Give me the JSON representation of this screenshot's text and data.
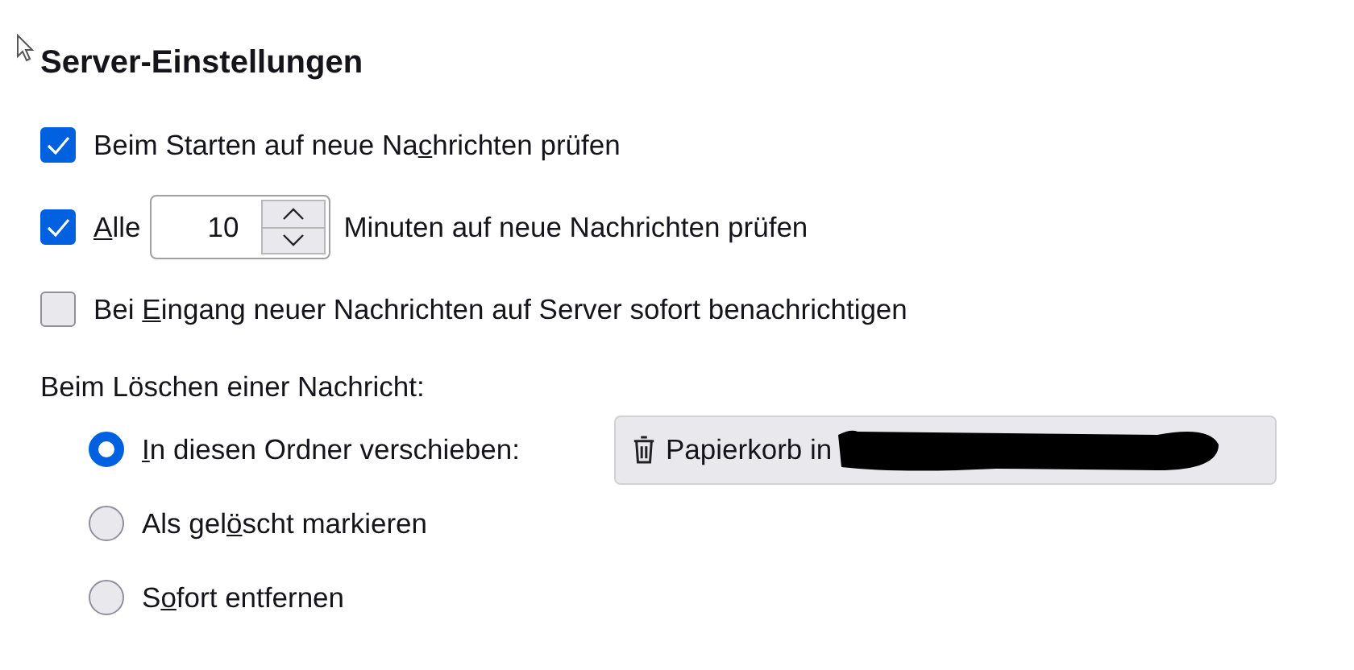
{
  "heading": "Server-Einstellungen",
  "options": [
    {
      "kind": "checkbox",
      "checked": true,
      "label": [
        "Beim Starten auf neue Na",
        "c",
        "hrichten prüfen"
      ]
    },
    {
      "kind": "interval",
      "checked": true,
      "label": [
        "A",
        "lle"
      ],
      "value": "10",
      "suffix": "Minuten auf neue Nachrichten prüfen"
    },
    {
      "kind": "checkbox",
      "checked": false,
      "label": [
        "Bei ",
        "E",
        "ingang neuer Nachrichten auf Server sofort benachrichtigen"
      ]
    }
  ],
  "delete_group": {
    "title": "Beim Löschen einer Nachricht:",
    "choices": [
      {
        "selected": true,
        "label": [
          "I",
          "n diesen Ordner verschieben:"
        ],
        "folder": {
          "label": "Papierkorb in",
          "redacted": true
        }
      },
      {
        "selected": false,
        "label": [
          "Als gel",
          "ö",
          "scht markieren"
        ]
      },
      {
        "selected": false,
        "label": [
          "S",
          "o",
          "fort entfernen"
        ]
      }
    ]
  }
}
